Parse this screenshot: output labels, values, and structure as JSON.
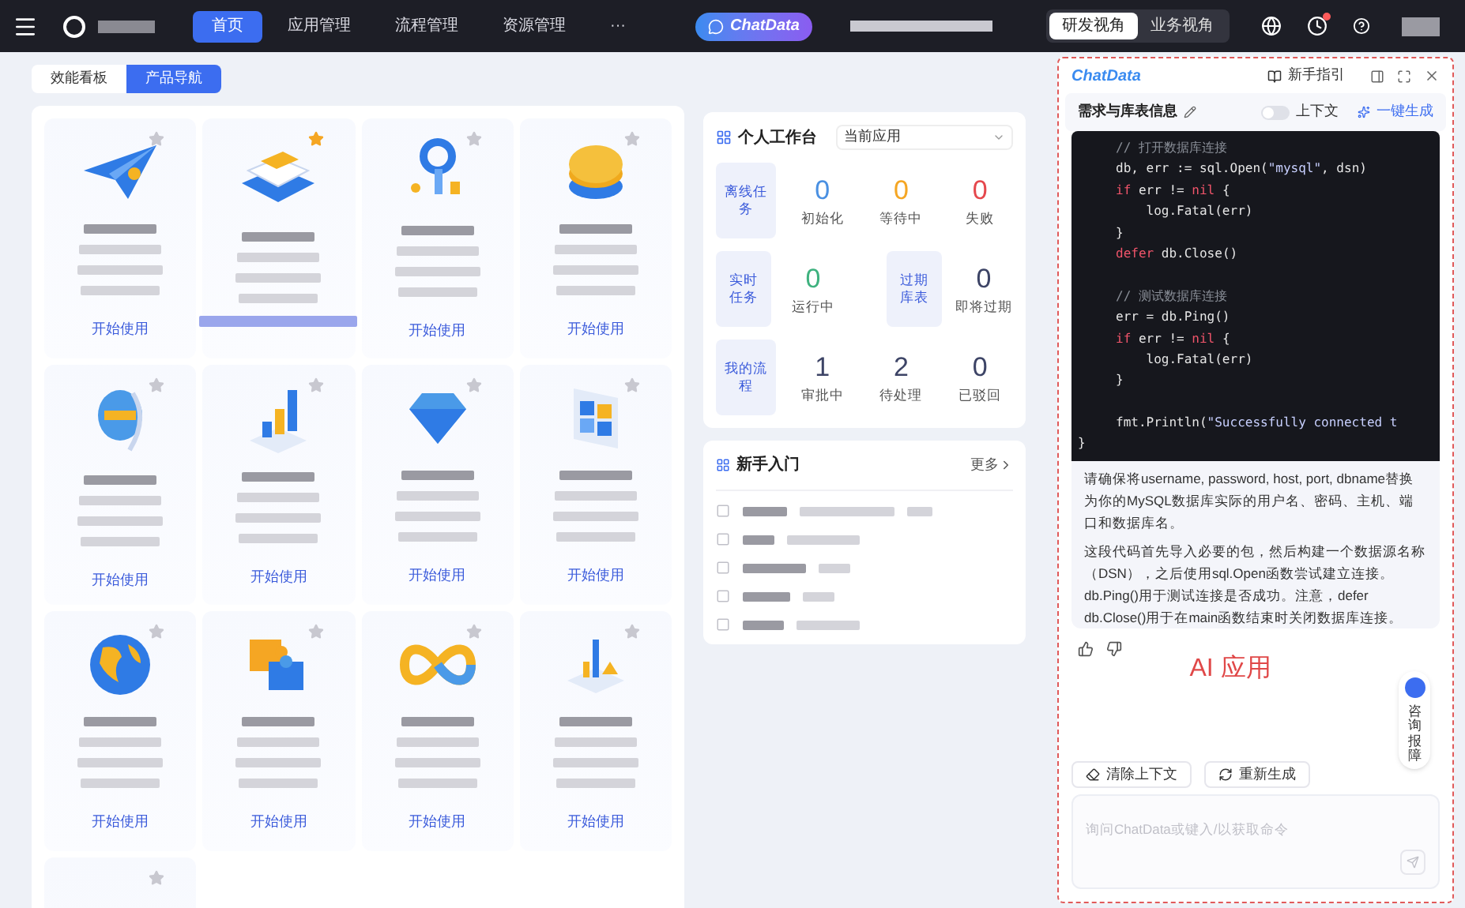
{
  "header": {
    "nav": [
      {
        "label": "首页",
        "selected": true
      },
      {
        "label": "应用管理",
        "selected": false
      },
      {
        "label": "流程管理",
        "selected": false
      },
      {
        "label": "资源管理",
        "selected": false
      },
      {
        "label": "···",
        "selected": false
      }
    ],
    "chat_button": "ChatData",
    "views": [
      {
        "label": "研发视角",
        "selected": true
      },
      {
        "label": "业务视角",
        "selected": false
      }
    ],
    "notification": true
  },
  "tabs": [
    {
      "label": "效能看板",
      "selected": false
    },
    {
      "label": "产品导航",
      "selected": true
    }
  ],
  "products": [
    {
      "starred": false,
      "link": "开始使用"
    },
    {
      "starred": true
    },
    {
      "starred": false,
      "link": "开始使用"
    },
    {
      "starred": false,
      "link": "开始使用"
    },
    {
      "starred": false,
      "link": "开始使用"
    },
    {
      "starred": false,
      "link": "开始使用"
    },
    {
      "starred": false,
      "link": "开始使用"
    },
    {
      "starred": false,
      "link": "开始使用"
    },
    {
      "starred": false,
      "link": "开始使用"
    },
    {
      "starred": false,
      "link": "开始使用"
    },
    {
      "starred": false,
      "link": "开始使用"
    },
    {
      "starred": false,
      "link": "开始使用"
    },
    {
      "starred": false
    }
  ],
  "workbench": {
    "title": "个人工作台",
    "select_label": "当前应用",
    "groups": [
      {
        "label": "离线任务",
        "stats": [
          {
            "value": "0",
            "label": "初始化",
            "color": "#4a90e2"
          },
          {
            "value": "0",
            "label": "等待中",
            "color": "#f5a623"
          },
          {
            "value": "0",
            "label": "失败",
            "color": "#e5484d"
          }
        ]
      },
      {
        "label": "实时任务",
        "stats": [
          {
            "value": "0",
            "label": "运行中",
            "color": "#3fb27f"
          }
        ]
      },
      {
        "label": "过期库表",
        "stats": [
          {
            "value": "0",
            "label": "即将过期",
            "color": "#3d4466"
          }
        ]
      },
      {
        "label": "我的流程",
        "stats": [
          {
            "value": "1",
            "label": "审批中",
            "color": "#3d4466"
          },
          {
            "value": "2",
            "label": "待处理",
            "color": "#3d4466"
          },
          {
            "value": "0",
            "label": "已驳回",
            "color": "#3d4466"
          }
        ]
      }
    ]
  },
  "guide": {
    "title": "新手入门",
    "more": "更多",
    "items": [
      {
        "checked": false
      },
      {
        "checked": false
      },
      {
        "checked": false
      },
      {
        "checked": false
      },
      {
        "checked": false
      }
    ]
  },
  "chat": {
    "logo": "ChatData",
    "guide_link": "新手指引",
    "info_label": "需求与库表信息",
    "context_toggle": {
      "label": "上下文",
      "on": false
    },
    "generate": "一键生成",
    "code": [
      {
        "indent": true,
        "tokens": [
          {
            "text": "// 打开数据库连接",
            "kind": "comment"
          }
        ]
      },
      {
        "indent": true,
        "tokens": [
          {
            "text": "db, err := sql.Open(",
            "kind": "plain"
          },
          {
            "text": "\"mysql\"",
            "kind": "string"
          },
          {
            "text": ", dsn)",
            "kind": "plain"
          }
        ]
      },
      {
        "indent": true,
        "tokens": [
          {
            "text": "if",
            "kind": "keyword"
          },
          {
            "text": " err != ",
            "kind": "plain"
          },
          {
            "text": "nil",
            "kind": "keyword"
          },
          {
            "text": " {",
            "kind": "plain"
          }
        ]
      },
      {
        "indent": true,
        "tokens": [
          {
            "text": "    log.Fatal(err)",
            "kind": "plain"
          }
        ]
      },
      {
        "indent": true,
        "tokens": [
          {
            "text": "}",
            "kind": "plain"
          }
        ]
      },
      {
        "indent": true,
        "tokens": [
          {
            "text": "defer",
            "kind": "keyword"
          },
          {
            "text": " db.Close()",
            "kind": "plain"
          }
        ]
      },
      {
        "indent": true,
        "space_before": true,
        "tokens": [
          {
            "text": "// 测试数据库连接",
            "kind": "comment"
          }
        ]
      },
      {
        "indent": true,
        "tokens": [
          {
            "text": "err = db.Ping()",
            "kind": "plain"
          }
        ]
      },
      {
        "indent": true,
        "tokens": [
          {
            "text": "if",
            "kind": "keyword"
          },
          {
            "text": " err != ",
            "kind": "plain"
          },
          {
            "text": "nil",
            "kind": "keyword"
          },
          {
            "text": " {",
            "kind": "plain"
          }
        ]
      },
      {
        "indent": true,
        "tokens": [
          {
            "text": "    log.Fatal(err)",
            "kind": "plain"
          }
        ]
      },
      {
        "indent": true,
        "tokens": [
          {
            "text": "}",
            "kind": "plain"
          }
        ]
      },
      {
        "indent": true,
        "space_before": true,
        "tokens": [
          {
            "text": "fmt.Println(",
            "kind": "plain"
          },
          {
            "text": "\"Successfully connected t",
            "kind": "string"
          }
        ]
      },
      {
        "indent": false,
        "tokens": [
          {
            "text": "}",
            "kind": "plain"
          }
        ]
      }
    ],
    "paragraphs": [
      "请确保将username, password, host, port, dbname替换为你的MySQL数据库实际的用户名、密码、主机、端口和数据库名。",
      "这段代码首先导入必要的包，然后构建一个数据源名称（DSN），之后使用sql.Open函数尝试建立连接。db.Ping()用于测试连接是否成功。注意，defer db.Close()用于在main函数结束时关闭数据库连接。"
    ],
    "annotation": "AI 应用",
    "float_button": "咨询报障",
    "actions": [
      "清除上下文",
      "重新生成"
    ],
    "input": {
      "placeholder": "询问ChatData或键入/以获取命令"
    }
  }
}
